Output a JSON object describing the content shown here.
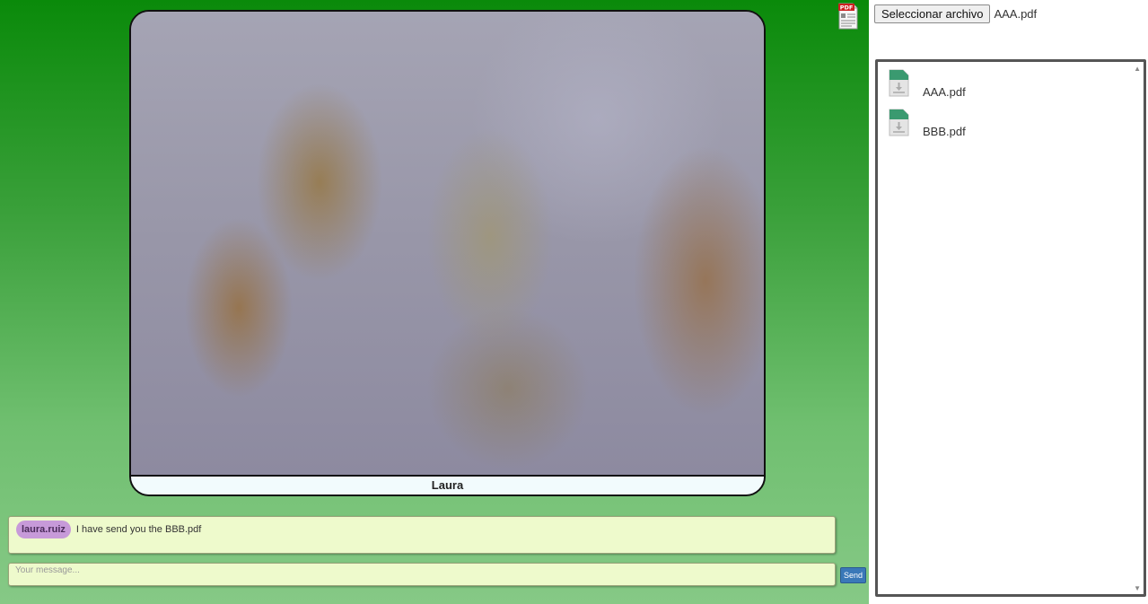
{
  "video": {
    "participant_name": "Laura"
  },
  "toolbar": {
    "pdf_icon": "pdf-file-icon"
  },
  "chat": {
    "messages": [
      {
        "user": "laura.ruiz",
        "text": "I have send you the BBB.pdf"
      }
    ],
    "input_placeholder": "Your message...",
    "send_label": "Send"
  },
  "upload": {
    "button_label": "Seleccionar archivo",
    "selected_file": "AAA.pdf"
  },
  "files": {
    "items": [
      {
        "name": "AAA.pdf",
        "icon": "file-download-icon"
      },
      {
        "name": "BBB.pdf",
        "icon": "file-download-icon"
      }
    ]
  },
  "colors": {
    "accent_green": "#0a8a0a",
    "chat_background": "#eefacc",
    "user_badge": "#c79ad9",
    "send_button": "#3a78b8"
  }
}
